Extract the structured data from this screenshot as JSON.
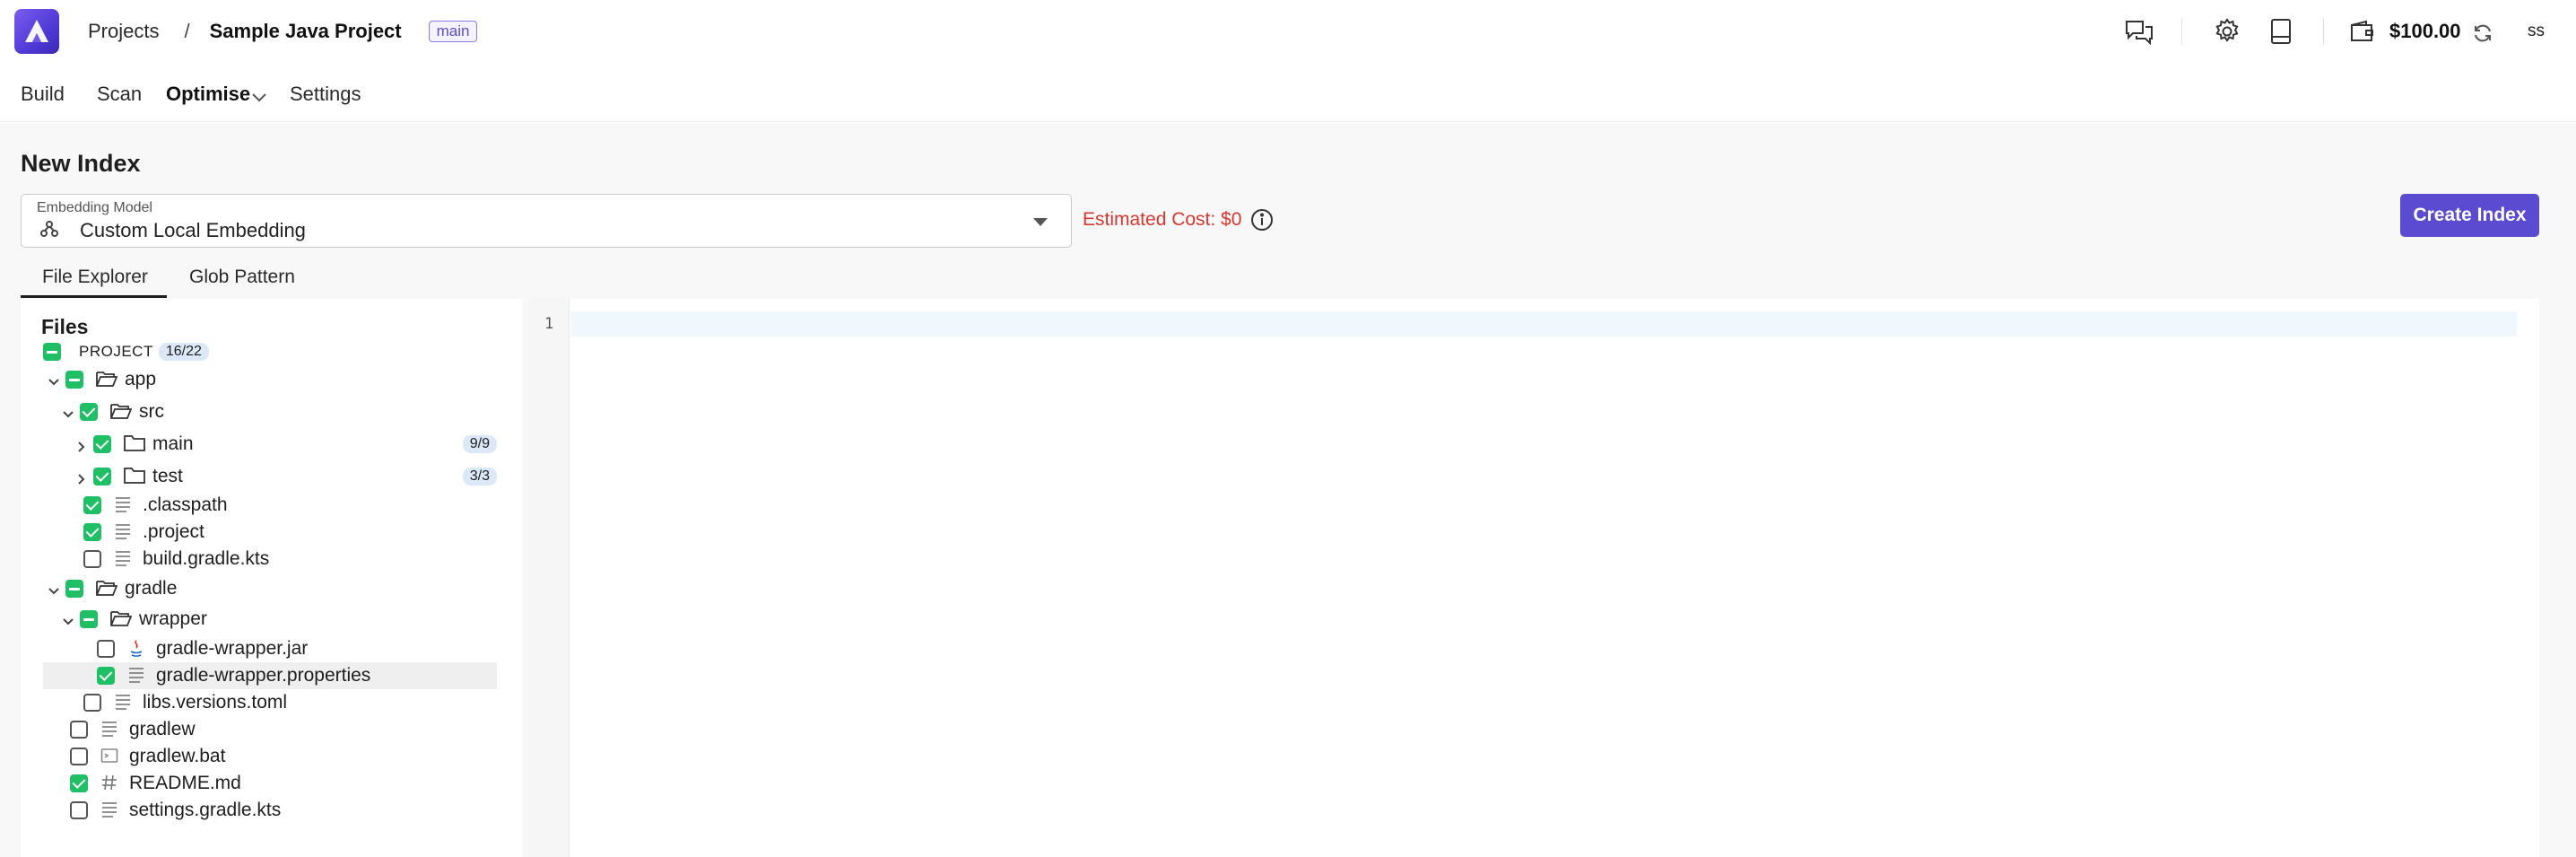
{
  "header": {
    "crumb_projects": "Projects",
    "crumb_sep": "/",
    "project_name": "Sample Java Project",
    "branch": "main",
    "balance": "$100.00",
    "user_initials": "ss"
  },
  "subnav": {
    "build": "Build",
    "scan": "Scan",
    "optimise": "Optimise",
    "settings": "Settings"
  },
  "page": {
    "title": "New Index",
    "embedding_label": "Embedding Model",
    "embedding_value": "Custom Local Embedding",
    "estimated_cost": "Estimated Cost: $0",
    "create_button": "Create Index"
  },
  "tabs": {
    "file_explorer": "File Explorer",
    "glob_pattern": "Glob Pattern"
  },
  "files": {
    "title": "Files",
    "project_label": "PROJECT",
    "project_count": "16/22",
    "items": {
      "app": "app",
      "src": "src",
      "main": "main",
      "main_count": "9/9",
      "test": "test",
      "test_count": "3/3",
      "classpath": ".classpath",
      "project": ".project",
      "build_gradle": "build.gradle.kts",
      "gradle": "gradle",
      "wrapper": "wrapper",
      "wrapper_jar": "gradle-wrapper.jar",
      "wrapper_props": "gradle-wrapper.properties",
      "libs_versions": "libs.versions.toml",
      "gradlew": "gradlew",
      "gradlew_bat": "gradlew.bat",
      "readme": "README.md",
      "settings_gradle": "settings.gradle.kts"
    }
  },
  "editor": {
    "line_1": "1"
  },
  "colors": {
    "accent": "#5b4bd1",
    "checkbox_green": "#1fbf66",
    "cost_red": "#d9372f"
  },
  "icons": [
    "logo-icon",
    "chat-icon",
    "gear-icon",
    "book-icon",
    "wallet-icon",
    "refresh-icon",
    "chevron-down-icon",
    "folder-icon",
    "file-lines-icon",
    "java-icon",
    "terminal-icon",
    "hash-icon",
    "info-icon",
    "model-icon"
  ]
}
